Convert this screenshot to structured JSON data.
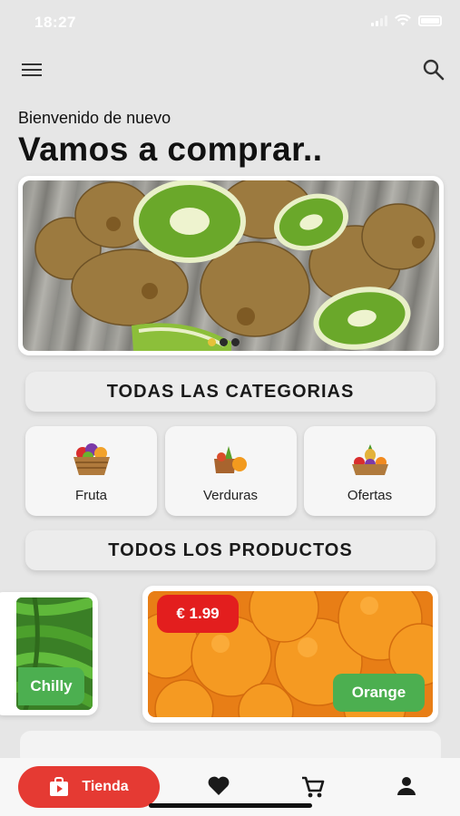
{
  "status_bar": {
    "time": "18:27"
  },
  "header": {
    "welcome": "Bienvenido de nuevo",
    "headline": "Vamos a comprar.."
  },
  "banner": {
    "image": "kiwi-fruits",
    "slides": 3,
    "active_slide": 1
  },
  "categories_section": {
    "title": "TODAS LAS CATEGORIAS",
    "items": [
      {
        "label": "Fruta",
        "icon": "fruit-basket-icon"
      },
      {
        "label": "Verduras",
        "icon": "vegetables-icon"
      },
      {
        "label": "Ofertas",
        "icon": "offers-basket-icon"
      }
    ]
  },
  "products_section": {
    "title": "TODOS LOS PRODUCTOS",
    "items": [
      {
        "name": "Chilly",
        "image": "green-chillies"
      },
      {
        "name": "Orange",
        "price": "€ 1.99",
        "image": "oranges"
      }
    ]
  },
  "bottom_nav": {
    "active_label": "Tienda",
    "items": [
      "store-icon",
      "heart-icon",
      "cart-icon",
      "profile-icon"
    ]
  },
  "colors": {
    "accent_red": "#e53a33",
    "price_red": "#e31e1e",
    "name_green": "#4caf50",
    "background": "#e6e6e6"
  }
}
